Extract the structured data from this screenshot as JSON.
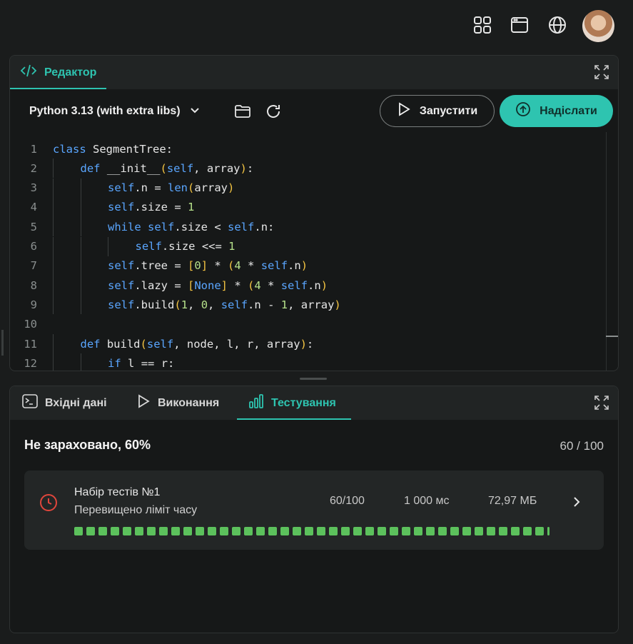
{
  "header": {
    "icons": [
      "apps-grid-icon",
      "browser-window-icon",
      "globe-icon"
    ]
  },
  "editor": {
    "tab_label": "Редактор",
    "language": "Python 3.13 (with extra libs)",
    "run_label": "Запустити",
    "submit_label": "Надіслати",
    "lines": [
      {
        "n": "1",
        "indent": 0
      },
      {
        "n": "2",
        "indent": 1
      },
      {
        "n": "3",
        "indent": 2
      },
      {
        "n": "4",
        "indent": 2
      },
      {
        "n": "5",
        "indent": 2
      },
      {
        "n": "6",
        "indent": 3
      },
      {
        "n": "7",
        "indent": 2
      },
      {
        "n": "8",
        "indent": 2
      },
      {
        "n": "9",
        "indent": 2
      },
      {
        "n": "10",
        "indent": 0
      },
      {
        "n": "11",
        "indent": 1
      },
      {
        "n": "12",
        "indent": 2
      }
    ],
    "code": [
      "class SegmentTree:",
      "def __init__(self, array):",
      "self.n = len(array)",
      "self.size = 1",
      "while self.size < self.n:",
      "self.size <<= 1",
      "self.tree = [0] * (4 * self.n)",
      "self.lazy = [None] * (4 * self.n)",
      "self.build(1, 0, self.n - 1, array)",
      "",
      "def build(self, node, l, r, array):",
      "if l == r:"
    ]
  },
  "bottom": {
    "tabs": [
      {
        "label": "Вхідні дані"
      },
      {
        "label": "Виконання"
      },
      {
        "label": "Тестування"
      }
    ],
    "active_tab": "Тестування",
    "verdict": "Не зараховано, 60%",
    "score": "60 / 100",
    "test_set": {
      "title": "Набір тестів №1",
      "status": "Перевищено ліміт часу",
      "points": "60/100",
      "time": "1 000 мс",
      "memory": "72,97 МБ",
      "passed_dots": 40,
      "dot_color": "#5cc15c"
    }
  },
  "colors": {
    "accent": "#2ec4b0",
    "error": "#e0463c",
    "keyword": "#5aa6ff",
    "number": "#b5e08a",
    "bracket": "#f5c542"
  }
}
